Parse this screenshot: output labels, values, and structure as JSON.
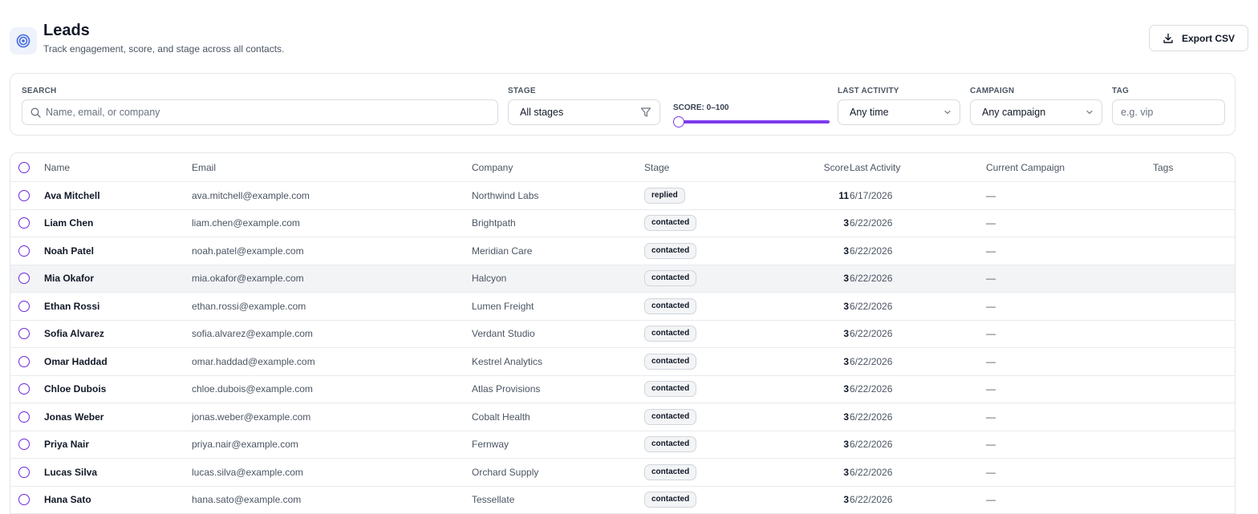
{
  "header": {
    "title": "Leads",
    "subtitle": "Track engagement, score, and stage across all contacts.",
    "logo_icon": "target-icon",
    "export_label": "Export CSV",
    "accent": "#4169e1"
  },
  "filters": {
    "search": {
      "label": "SEARCH",
      "placeholder": "Name, email, or company",
      "value": ""
    },
    "stage": {
      "label": "STAGE",
      "value": "All stages"
    },
    "score": {
      "label": "SCORE: 0–100",
      "min": 0,
      "max": 100
    },
    "activity": {
      "label": "LAST ACTIVITY",
      "value": "Any time"
    },
    "campaign": {
      "label": "CAMPAIGN",
      "value": "Any campaign"
    },
    "tag": {
      "label": "TAG",
      "placeholder": "e.g. vip",
      "value": ""
    }
  },
  "table": {
    "columns": {
      "name": "Name",
      "email": "Email",
      "company": "Company",
      "stage": "Stage",
      "score": "Score",
      "activity": "Last Activity",
      "campaign": "Current Campaign",
      "tags": "Tags"
    },
    "rows": [
      {
        "name": "Ava Mitchell",
        "email": "ava.mitchell@example.com",
        "company": "Northwind Labs",
        "stage": "replied",
        "score": "11",
        "activity": "6/17/2026",
        "campaign": "—",
        "tags": ""
      },
      {
        "name": "Liam Chen",
        "email": "liam.chen@example.com",
        "company": "Brightpath",
        "stage": "contacted",
        "score": "3",
        "activity": "6/22/2026",
        "campaign": "—",
        "tags": ""
      },
      {
        "name": "Noah Patel",
        "email": "noah.patel@example.com",
        "company": "Meridian Care",
        "stage": "contacted",
        "score": "3",
        "activity": "6/22/2026",
        "campaign": "—",
        "tags": ""
      },
      {
        "name": "Mia Okafor",
        "email": "mia.okafor@example.com",
        "company": "Halcyon",
        "stage": "contacted",
        "score": "3",
        "activity": "6/22/2026",
        "campaign": "—",
        "tags": ""
      },
      {
        "name": "Ethan Rossi",
        "email": "ethan.rossi@example.com",
        "company": "Lumen Freight",
        "stage": "contacted",
        "score": "3",
        "activity": "6/22/2026",
        "campaign": "—",
        "tags": ""
      },
      {
        "name": "Sofia Alvarez",
        "email": "sofia.alvarez@example.com",
        "company": "Verdant Studio",
        "stage": "contacted",
        "score": "3",
        "activity": "6/22/2026",
        "campaign": "—",
        "tags": ""
      },
      {
        "name": "Omar Haddad",
        "email": "omar.haddad@example.com",
        "company": "Kestrel Analytics",
        "stage": "contacted",
        "score": "3",
        "activity": "6/22/2026",
        "campaign": "—",
        "tags": ""
      },
      {
        "name": "Chloe Dubois",
        "email": "chloe.dubois@example.com",
        "company": "Atlas Provisions",
        "stage": "contacted",
        "score": "3",
        "activity": "6/22/2026",
        "campaign": "—",
        "tags": ""
      },
      {
        "name": "Jonas Weber",
        "email": "jonas.weber@example.com",
        "company": "Cobalt Health",
        "stage": "contacted",
        "score": "3",
        "activity": "6/22/2026",
        "campaign": "—",
        "tags": ""
      },
      {
        "name": "Priya Nair",
        "email": "priya.nair@example.com",
        "company": "Fernway",
        "stage": "contacted",
        "score": "3",
        "activity": "6/22/2026",
        "campaign": "—",
        "tags": ""
      },
      {
        "name": "Lucas Silva",
        "email": "lucas.silva@example.com",
        "company": "Orchard Supply",
        "stage": "contacted",
        "score": "3",
        "activity": "6/22/2026",
        "campaign": "—",
        "tags": ""
      },
      {
        "name": "Hana Sato",
        "email": "hana.sato@example.com",
        "company": "Tessellate",
        "stage": "contacted",
        "score": "3",
        "activity": "6/22/2026",
        "campaign": "—",
        "tags": ""
      }
    ]
  }
}
